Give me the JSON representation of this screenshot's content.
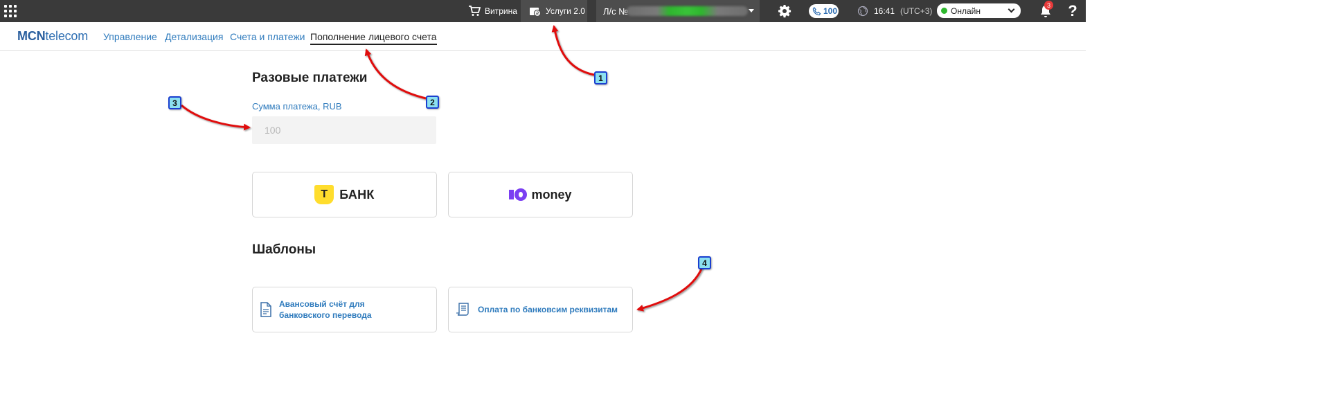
{
  "topbar": {
    "vitrina_label": "Витрина",
    "uslugi_label": "Услуги 2.0",
    "account_label": "Л/с №",
    "phone_count": "100",
    "time": "16:41",
    "timezone": "(UTC+3)",
    "status_label": "Онлайн",
    "notifications_count": "3",
    "help_label": "?"
  },
  "nav": {
    "logo_bold": "MCN",
    "logo_rest": "telecom",
    "links": [
      "Управление",
      "Детализация",
      "Счета и платежи",
      "Пополнение лицевого счета"
    ],
    "active_index": 3
  },
  "payment": {
    "heading": "Разовые платежи",
    "amount_label": "Сумма платежа, RUB",
    "amount_placeholder": "100",
    "providers": [
      {
        "name": "БАНК",
        "logo_letter": "Т",
        "icon": "tbank-logo-icon"
      },
      {
        "name": "money",
        "icon": "yoomoney-logo-icon"
      }
    ]
  },
  "templates": {
    "heading": "Шаблоны",
    "items": [
      {
        "label": "Авансовый счёт для банковского перевода",
        "icon": "document-icon"
      },
      {
        "label": "Оплата по банковсим реквизитам",
        "icon": "receipt-icon"
      }
    ]
  },
  "annotations": {
    "callouts": [
      "1",
      "2",
      "3",
      "4"
    ],
    "callout_color": "#8ce0f0",
    "arrow_color": "#e01010"
  },
  "colors": {
    "topbar_bg": "#3a3a3a",
    "link": "#2f7bbd",
    "status_online": "#2eb82e",
    "badge": "#e83a3a"
  }
}
